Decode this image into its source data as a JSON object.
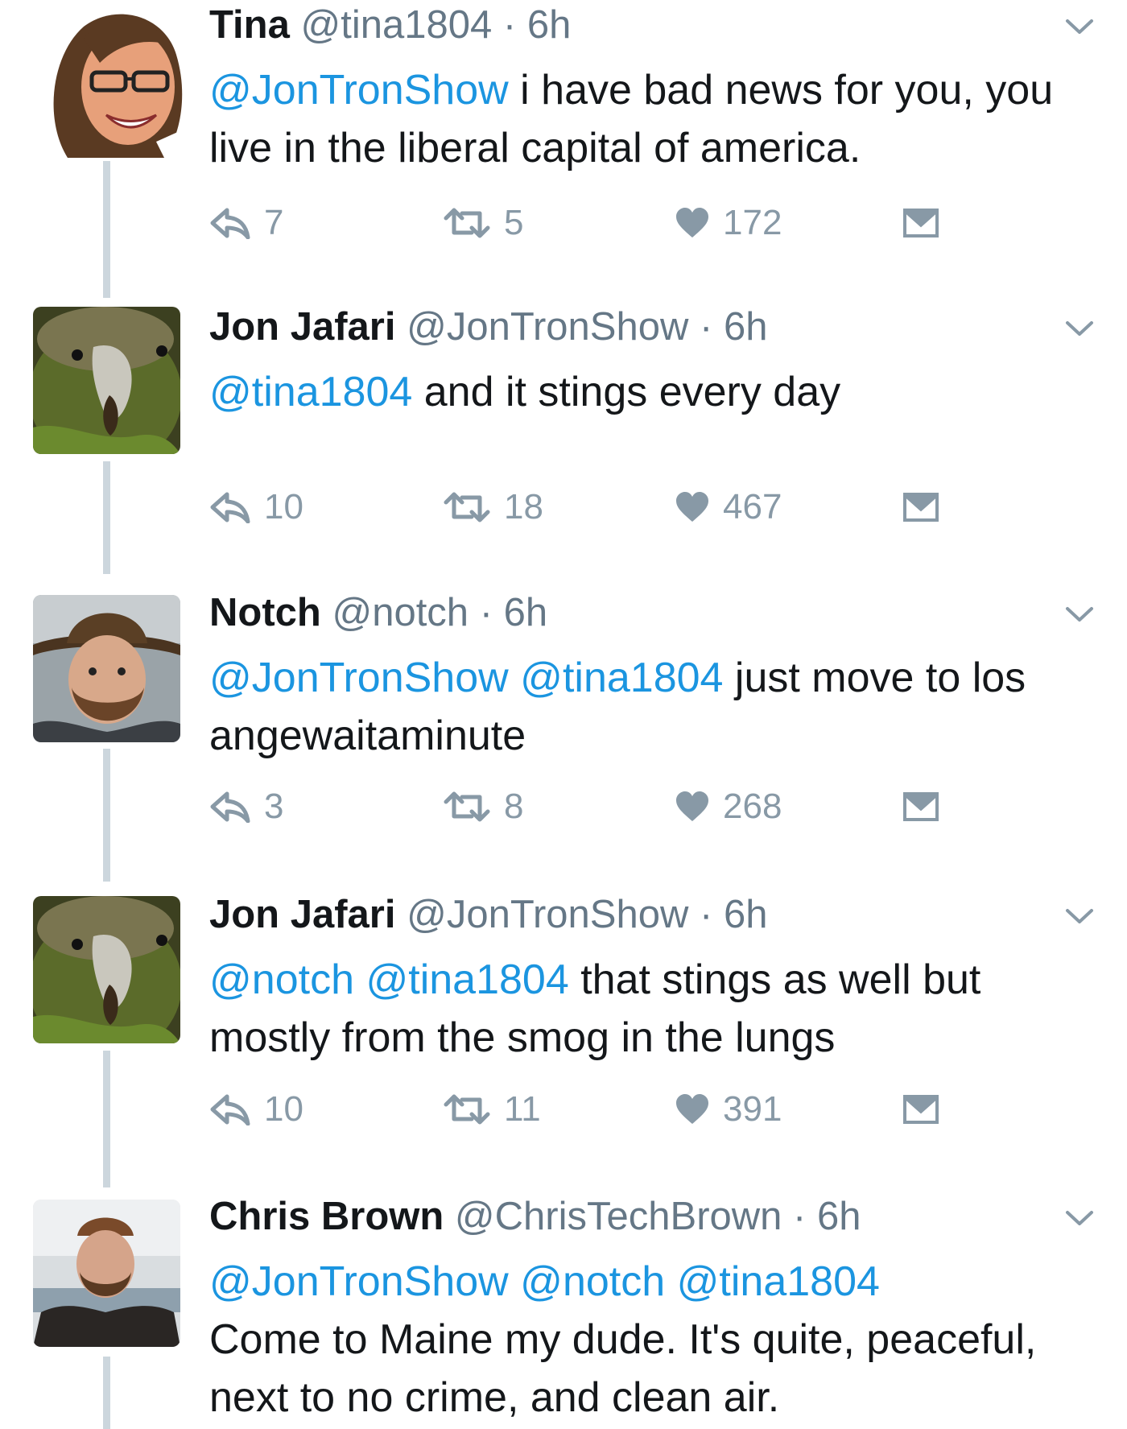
{
  "tweets": [
    {
      "name": "Tina",
      "handle": "@tina1804",
      "time": "6h",
      "mentions": [
        "@JonTronShow"
      ],
      "text": "i have bad news for you, you live in the liberal capital of america.",
      "replies": "7",
      "retweets": "5",
      "likes": "172"
    },
    {
      "name": "Jon Jafari",
      "handle": "@JonTronShow",
      "time": "6h",
      "mentions": [
        "@tina1804"
      ],
      "text": "and it stings every day",
      "replies": "10",
      "retweets": "18",
      "likes": "467"
    },
    {
      "name": "Notch",
      "handle": "@notch",
      "time": "6h",
      "mentions": [
        "@JonTronShow",
        "@tina1804"
      ],
      "text": "just move to los angewaitaminute",
      "replies": "3",
      "retweets": "8",
      "likes": "268"
    },
    {
      "name": "Jon Jafari",
      "handle": "@JonTronShow",
      "time": "6h",
      "mentions": [
        "@notch",
        "@tina1804"
      ],
      "text": "that stings as well but mostly from the smog in the lungs",
      "replies": "10",
      "retweets": "11",
      "likes": "391"
    },
    {
      "name": "Chris Brown",
      "handle": "@ChrisTechBrown",
      "time": "6h",
      "mentions": [
        "@JonTronShow",
        "@notch",
        "@tina1804"
      ],
      "text": "Come to Maine my dude. It's quite, peaceful, next to no crime, and clean air."
    }
  ],
  "separator": "·",
  "icons": {
    "reply": "reply-icon",
    "retweet": "retweet-icon",
    "like": "heart-icon",
    "dm": "envelope-icon",
    "menu": "chevron-down-icon"
  },
  "colors": {
    "mention": "#1b95e0",
    "muted": "#8899a6",
    "thread": "#ccd6dd"
  }
}
